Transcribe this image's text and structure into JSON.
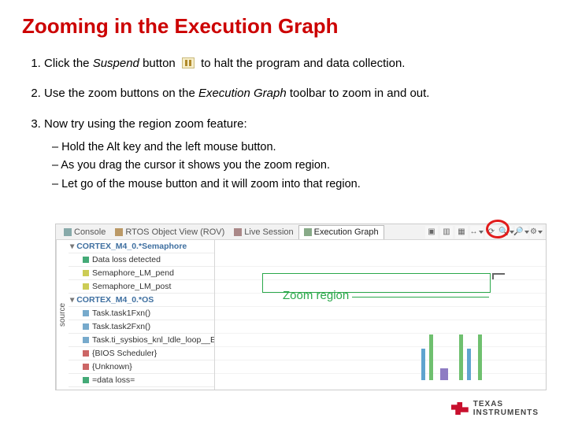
{
  "title": "Zooming in the Execution Graph",
  "steps": {
    "s1a": "Click the ",
    "s1i": "Suspend",
    "s1b": " button",
    "s1c": " to halt the program and data collection.",
    "s2a": "Use the zoom buttons on the ",
    "s2i": "Execution Graph",
    "s2b": " toolbar to zoom in and out.",
    "s3": "Now try using the region zoom feature:"
  },
  "sub": {
    "a": "Hold the Alt key and the left mouse button.",
    "b": "As you drag the cursor it shows you the zoom region.",
    "c": "Let go of the mouse button and it will zoom into that region."
  },
  "panel": {
    "tabs": {
      "console": "Console",
      "rov": "RTOS Object View (ROV)",
      "live": "Live Session",
      "exec": "Execution Graph"
    },
    "sidelabel": "source",
    "groups": {
      "g1": "CORTEX_M4_0.*Semaphore",
      "r11": "Data loss detected",
      "r12": "Semaphore_LM_pend",
      "r13": "Semaphore_LM_post",
      "g2": "CORTEX_M4_0.*OS",
      "r21": "Task.task1Fxn()",
      "r22": "Task.task2Fxn()",
      "r23": "Task.ti_sysbios_knl_Idle_loop__E()",
      "r24": "{BIOS Scheduler}",
      "r25": "{Unknown}",
      "r26": "=data loss="
    },
    "zoom_label": "Zoom region"
  },
  "brand": {
    "line1": "TEXAS",
    "line2": "INSTRUMENTS"
  }
}
